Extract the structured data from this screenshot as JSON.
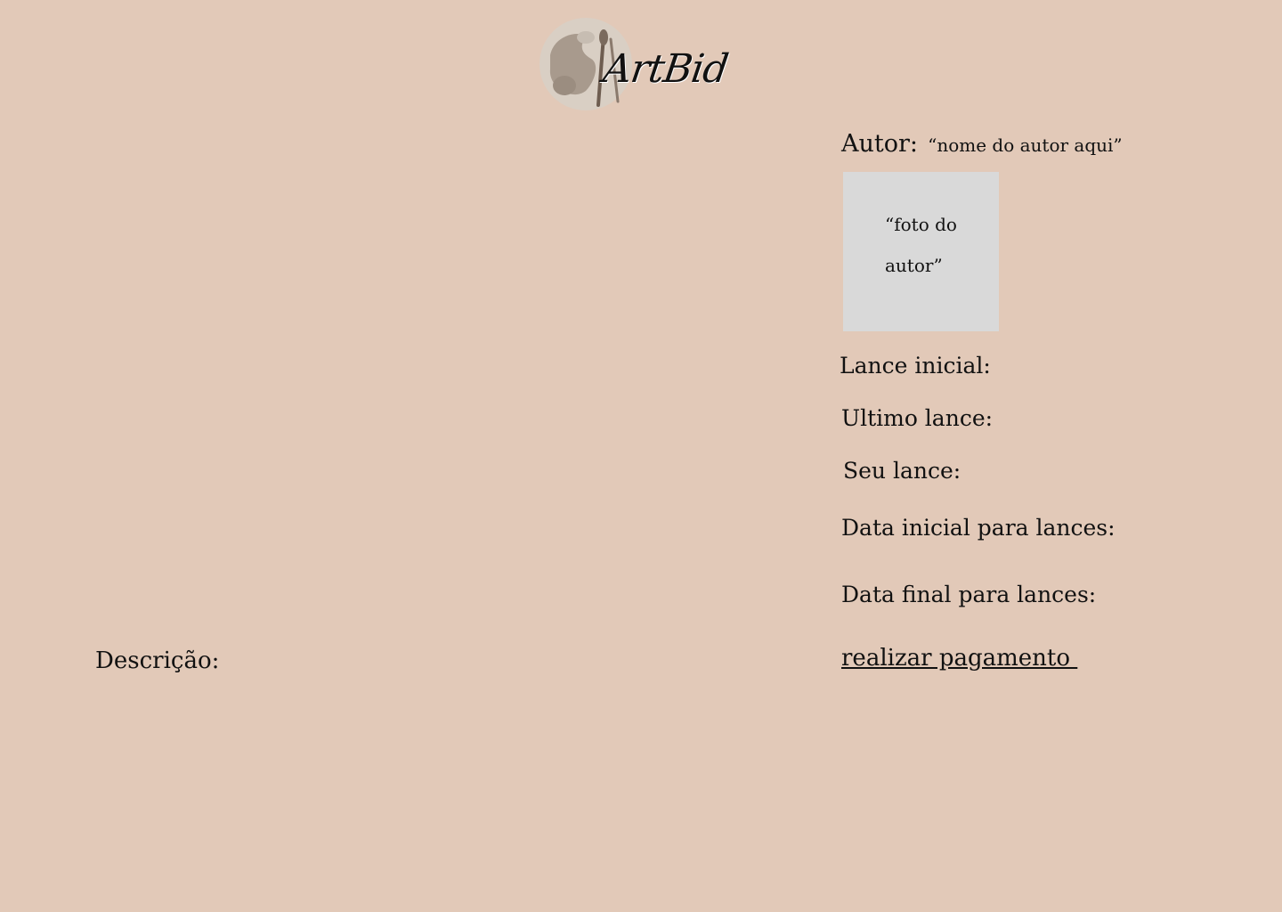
{
  "brand": {
    "logo_text": "ArtBid"
  },
  "author": {
    "label": "Autor:",
    "name": "“nome do autor aqui”",
    "photo_placeholder": "“foto do autor”"
  },
  "bid_info": {
    "initial_bid_label": "Lance inicial:",
    "last_bid_label": "Ultimo lance:",
    "your_bid_label": "Seu lance:",
    "start_date_label": "Data inicial para lances:",
    "end_date_label": "Data final para lances:"
  },
  "actions": {
    "payment_link": "realizar pagamento "
  },
  "description": {
    "label": "Descrição:"
  },
  "colors": {
    "background": "#e2c9b8",
    "photo_placeholder": "#d9d9d9",
    "text": "#111111"
  }
}
